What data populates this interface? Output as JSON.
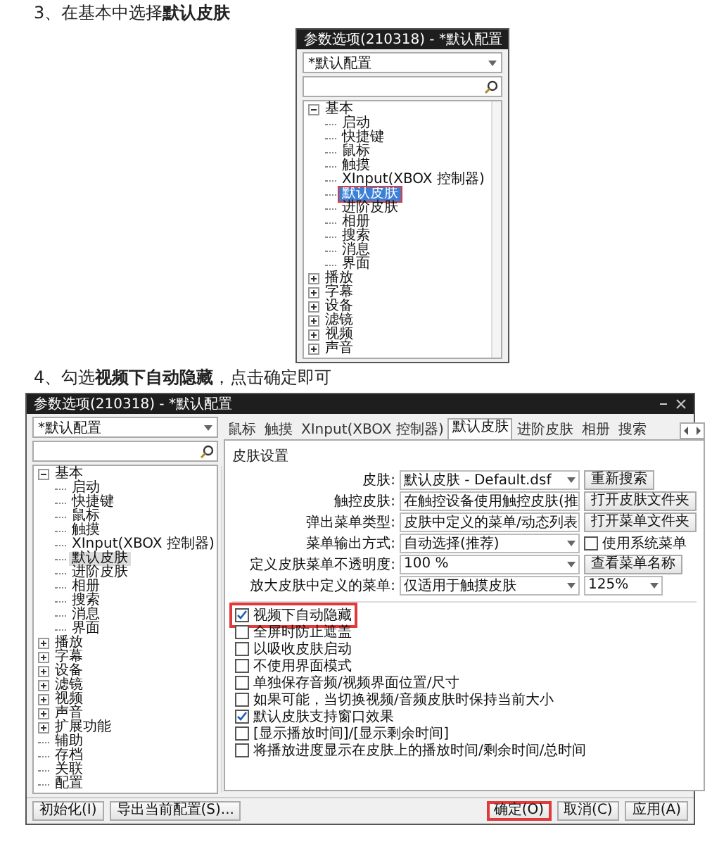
{
  "step_3_heading": "3、在基本中选择**默认皮肤**",
  "window_1": {
    "title": "参数选项(210318) - *默认配置",
    "profile": "*默认配置",
    "tree": [
      {
        "label": "基本",
        "expanded": true,
        "selected": false,
        "highlighted": false,
        "children": [
          {
            "label": "启动",
            "selected": false,
            "highlighted": false
          },
          {
            "label": "快捷键",
            "selected": false,
            "highlighted": false
          },
          {
            "label": "鼠标",
            "selected": false,
            "highlighted": false
          },
          {
            "label": "触摸",
            "selected": false,
            "highlighted": false
          },
          {
            "label": "XInput(XBOX 控制器)",
            "selected": false,
            "highlighted": false
          },
          {
            "label": "默认皮肤",
            "selected": true,
            "highlighted": true
          },
          {
            "label": "进阶皮肤",
            "selected": false,
            "highlighted": false
          },
          {
            "label": "相册",
            "selected": false,
            "highlighted": false
          },
          {
            "label": "搜索",
            "selected": false,
            "highlighted": false
          },
          {
            "label": "消息",
            "selected": false,
            "highlighted": false
          },
          {
            "label": "界面",
            "selected": false,
            "highlighted": false
          }
        ]
      },
      {
        "label": "播放",
        "expanded": false,
        "selected": false,
        "highlighted": false
      },
      {
        "label": "字幕",
        "expanded": false,
        "selected": false,
        "highlighted": false
      },
      {
        "label": "设备",
        "expanded": false,
        "selected": false,
        "highlighted": false
      },
      {
        "label": "滤镜",
        "expanded": false,
        "selected": false,
        "highlighted": false
      },
      {
        "label": "视频",
        "expanded": false,
        "selected": false,
        "highlighted": false
      },
      {
        "label": "声音",
        "expanded": false,
        "selected": false,
        "highlighted": false
      }
    ]
  },
  "step_4_heading": "4、勾选**视频下自动隐藏**，点击确定即可",
  "window_2": {
    "title": "参数选项(210318) - *默认配置",
    "profile": "*默认配置",
    "tree": [
      {
        "label": "基本",
        "expanded": true,
        "selected": false,
        "highlighted": false,
        "children": [
          {
            "label": "启动",
            "selected": false,
            "highlighted": false
          },
          {
            "label": "快捷键",
            "selected": false,
            "highlighted": false
          },
          {
            "label": "鼠标",
            "selected": false,
            "highlighted": false
          },
          {
            "label": "触摸",
            "selected": false,
            "highlighted": false
          },
          {
            "label": "XInput(XBOX 控制器)",
            "selected": false,
            "highlighted": false
          },
          {
            "label": "默认皮肤",
            "selected": true,
            "highlighted": false
          },
          {
            "label": "进阶皮肤",
            "selected": false,
            "highlighted": false
          },
          {
            "label": "相册",
            "selected": false,
            "highlighted": false
          },
          {
            "label": "搜索",
            "selected": false,
            "highlighted": false
          },
          {
            "label": "消息",
            "selected": false,
            "highlighted": false
          },
          {
            "label": "界面",
            "selected": false,
            "highlighted": false
          }
        ]
      },
      {
        "label": "播放",
        "expanded": false,
        "selected": false,
        "highlighted": false
      },
      {
        "label": "字幕",
        "expanded": false,
        "selected": false,
        "highlighted": false
      },
      {
        "label": "设备",
        "expanded": false,
        "selected": false,
        "highlighted": false
      },
      {
        "label": "滤镜",
        "expanded": false,
        "selected": false,
        "highlighted": false
      },
      {
        "label": "视频",
        "expanded": false,
        "selected": false,
        "highlighted": false
      },
      {
        "label": "声音",
        "expanded": false,
        "selected": false,
        "highlighted": false
      },
      {
        "label": "扩展功能",
        "expanded": false,
        "selected": false,
        "highlighted": false
      },
      {
        "label": "辅助",
        "selected": false,
        "highlighted": false
      },
      {
        "label": "存档",
        "selected": false,
        "highlighted": false
      },
      {
        "label": "关联",
        "selected": false,
        "highlighted": false
      },
      {
        "label": "配置",
        "selected": false,
        "highlighted": false
      }
    ],
    "tabs": [
      {
        "label": "鼠标",
        "selected": false
      },
      {
        "label": "触摸",
        "selected": false
      },
      {
        "label": "XInput(XBOX 控制器)",
        "selected": false
      },
      {
        "label": "默认皮肤",
        "selected": true
      },
      {
        "label": "进阶皮肤",
        "selected": false
      },
      {
        "label": "相册",
        "selected": false
      },
      {
        "label": "搜索",
        "selected": false
      }
    ],
    "group_title": "皮肤设置",
    "settings": [
      {
        "label": "皮肤:",
        "value": "默认皮肤 - Default.dsf",
        "extra": {
          "kind": "button",
          "label": "重新搜索"
        }
      },
      {
        "label": "触控皮肤:",
        "value": "在触控设备使用触控皮肤(推",
        "extra": {
          "kind": "button",
          "label": "打开皮肤文件夹"
        }
      },
      {
        "label": "弹出菜单类型:",
        "value": "皮肤中定义的菜单/动态列表",
        "extra": {
          "kind": "button",
          "label": "打开菜单文件夹"
        }
      },
      {
        "label": "菜单输出方式:",
        "value": "自动选择(推荐)",
        "extra": {
          "kind": "checkbox",
          "label": "使用系统菜单",
          "checked": false
        }
      },
      {
        "label": "定义皮肤菜单不透明度:",
        "value": "100 %",
        "extra": {
          "kind": "button",
          "label": "查看菜单名称"
        }
      },
      {
        "label": "放大皮肤中定义的菜单:",
        "value": "仅适用于触摸皮肤",
        "extra": {
          "kind": "select",
          "label": "125%"
        }
      }
    ],
    "options": [
      {
        "label": "视频下自动隐藏",
        "checked": true,
        "highlighted": true
      },
      {
        "label": "全屏时防止遮盖",
        "checked": false,
        "highlighted": false
      },
      {
        "label": "以吸收皮肤启动",
        "checked": false,
        "highlighted": false
      },
      {
        "label": "不使用界面模式",
        "checked": false,
        "highlighted": false
      },
      {
        "label": "单独保存音频/视频界面位置/尺寸",
        "checked": false,
        "highlighted": false
      },
      {
        "label": "如果可能，当切换视频/音频皮肤时保持当前大小",
        "checked": false,
        "highlighted": false
      },
      {
        "label": "默认皮肤支持窗口效果",
        "checked": true,
        "highlighted": false
      },
      {
        "label": "[显示播放时间]/[显示剩余时间]",
        "checked": false,
        "highlighted": false
      },
      {
        "label": "将播放进度显示在皮肤上的播放时间/剩余时间/总时间",
        "checked": false,
        "highlighted": false
      }
    ],
    "left_buttons": [
      {
        "label": "初始化(I)",
        "highlighted": false
      },
      {
        "label": "导出当前配置(S)...",
        "highlighted": false
      }
    ],
    "right_buttons": [
      {
        "label": "确定(O)",
        "highlighted": true
      },
      {
        "label": "取消(C)",
        "highlighted": false
      },
      {
        "label": "应用(A)",
        "highlighted": false
      }
    ]
  }
}
